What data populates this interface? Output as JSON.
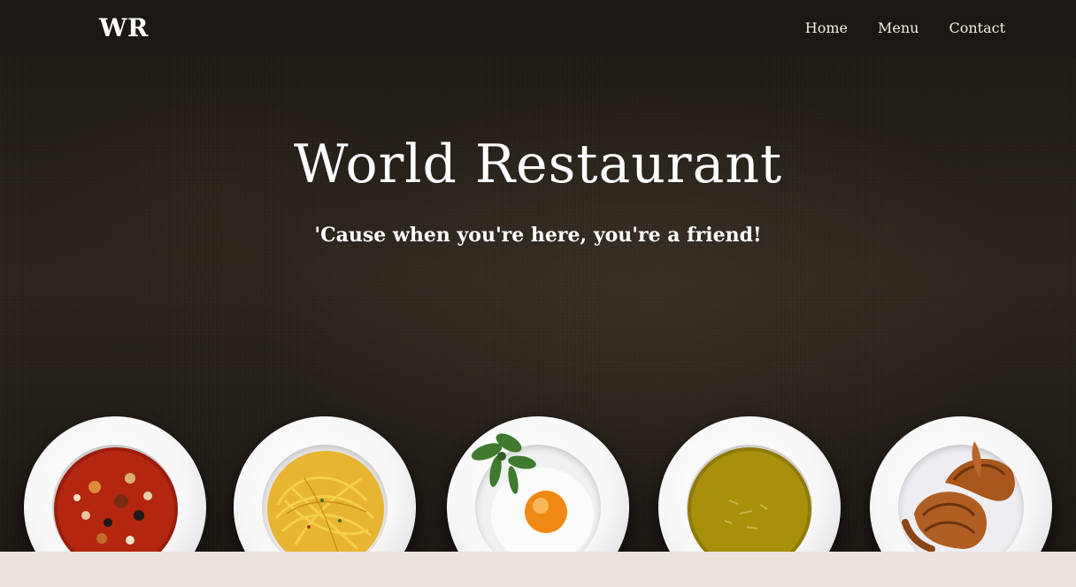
{
  "navbar": {
    "logo": "WR",
    "links": [
      "Home",
      "Menu",
      "Contact"
    ]
  },
  "hero": {
    "title": "World Restaurant",
    "tagline": "'Cause when you're here, you're a friend!"
  },
  "plates": [
    {
      "name": "soup-plate"
    },
    {
      "name": "spaghetti-plate"
    },
    {
      "name": "fried-egg-plate"
    },
    {
      "name": "cream-soup-plate"
    },
    {
      "name": "croissant-plate"
    }
  ],
  "colors": {
    "navbar": "#1c1712",
    "hero_bg": "#2a241c",
    "footer_band": "#ebe3dc",
    "text": "#ffffff"
  }
}
